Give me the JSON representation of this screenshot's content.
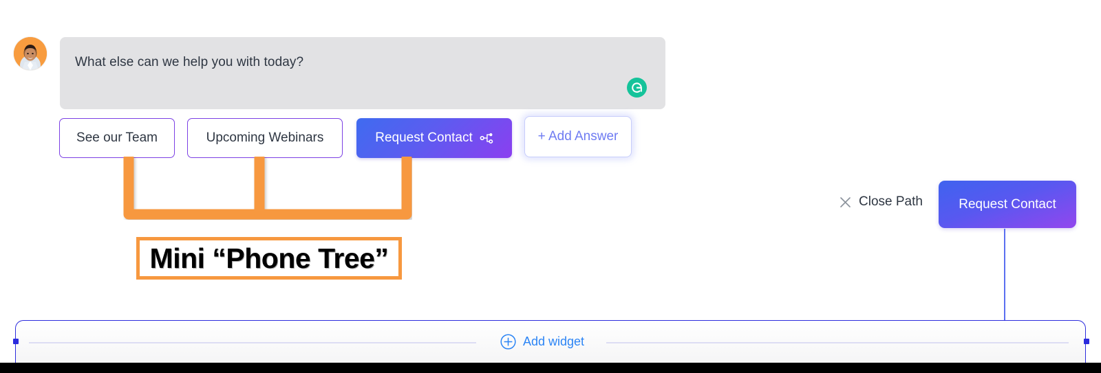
{
  "conversation": {
    "avatar": {
      "icon": "user-avatar-photo",
      "background_color": "#f89c3f"
    },
    "message": {
      "text": "What else can we help you with today?",
      "bubble_color": "#e2e2e4",
      "assistant_icon": "grammarly-icon",
      "assistant_icon_color": "#15c39a"
    }
  },
  "answers": {
    "options": [
      {
        "label": "See our Team",
        "style": "outline"
      },
      {
        "label": "Upcoming Webinars",
        "style": "outline"
      },
      {
        "label": "Request Contact",
        "style": "gradient",
        "icon": "branch-node-icon"
      }
    ],
    "add_answer_label": "+ Add Answer",
    "outline_color": "#7b3fe4",
    "gradient_from": "#3f6bf0",
    "gradient_to": "#8b3ff0",
    "add_answer_color": "#6e7bf2"
  },
  "annotation": {
    "bracket_color": "#f7983f",
    "callout_label": "Mini “Phone Tree”"
  },
  "path_panel": {
    "close_path_label": "Close Path",
    "close_icon": "close-x-icon",
    "request_contact_label": "Request Contact"
  },
  "widget_bar": {
    "add_widget_label": "Add widget",
    "add_widget_icon": "plus-circle-icon",
    "accent_color": "#2b84f5",
    "border_color": "#2b2bdd"
  }
}
